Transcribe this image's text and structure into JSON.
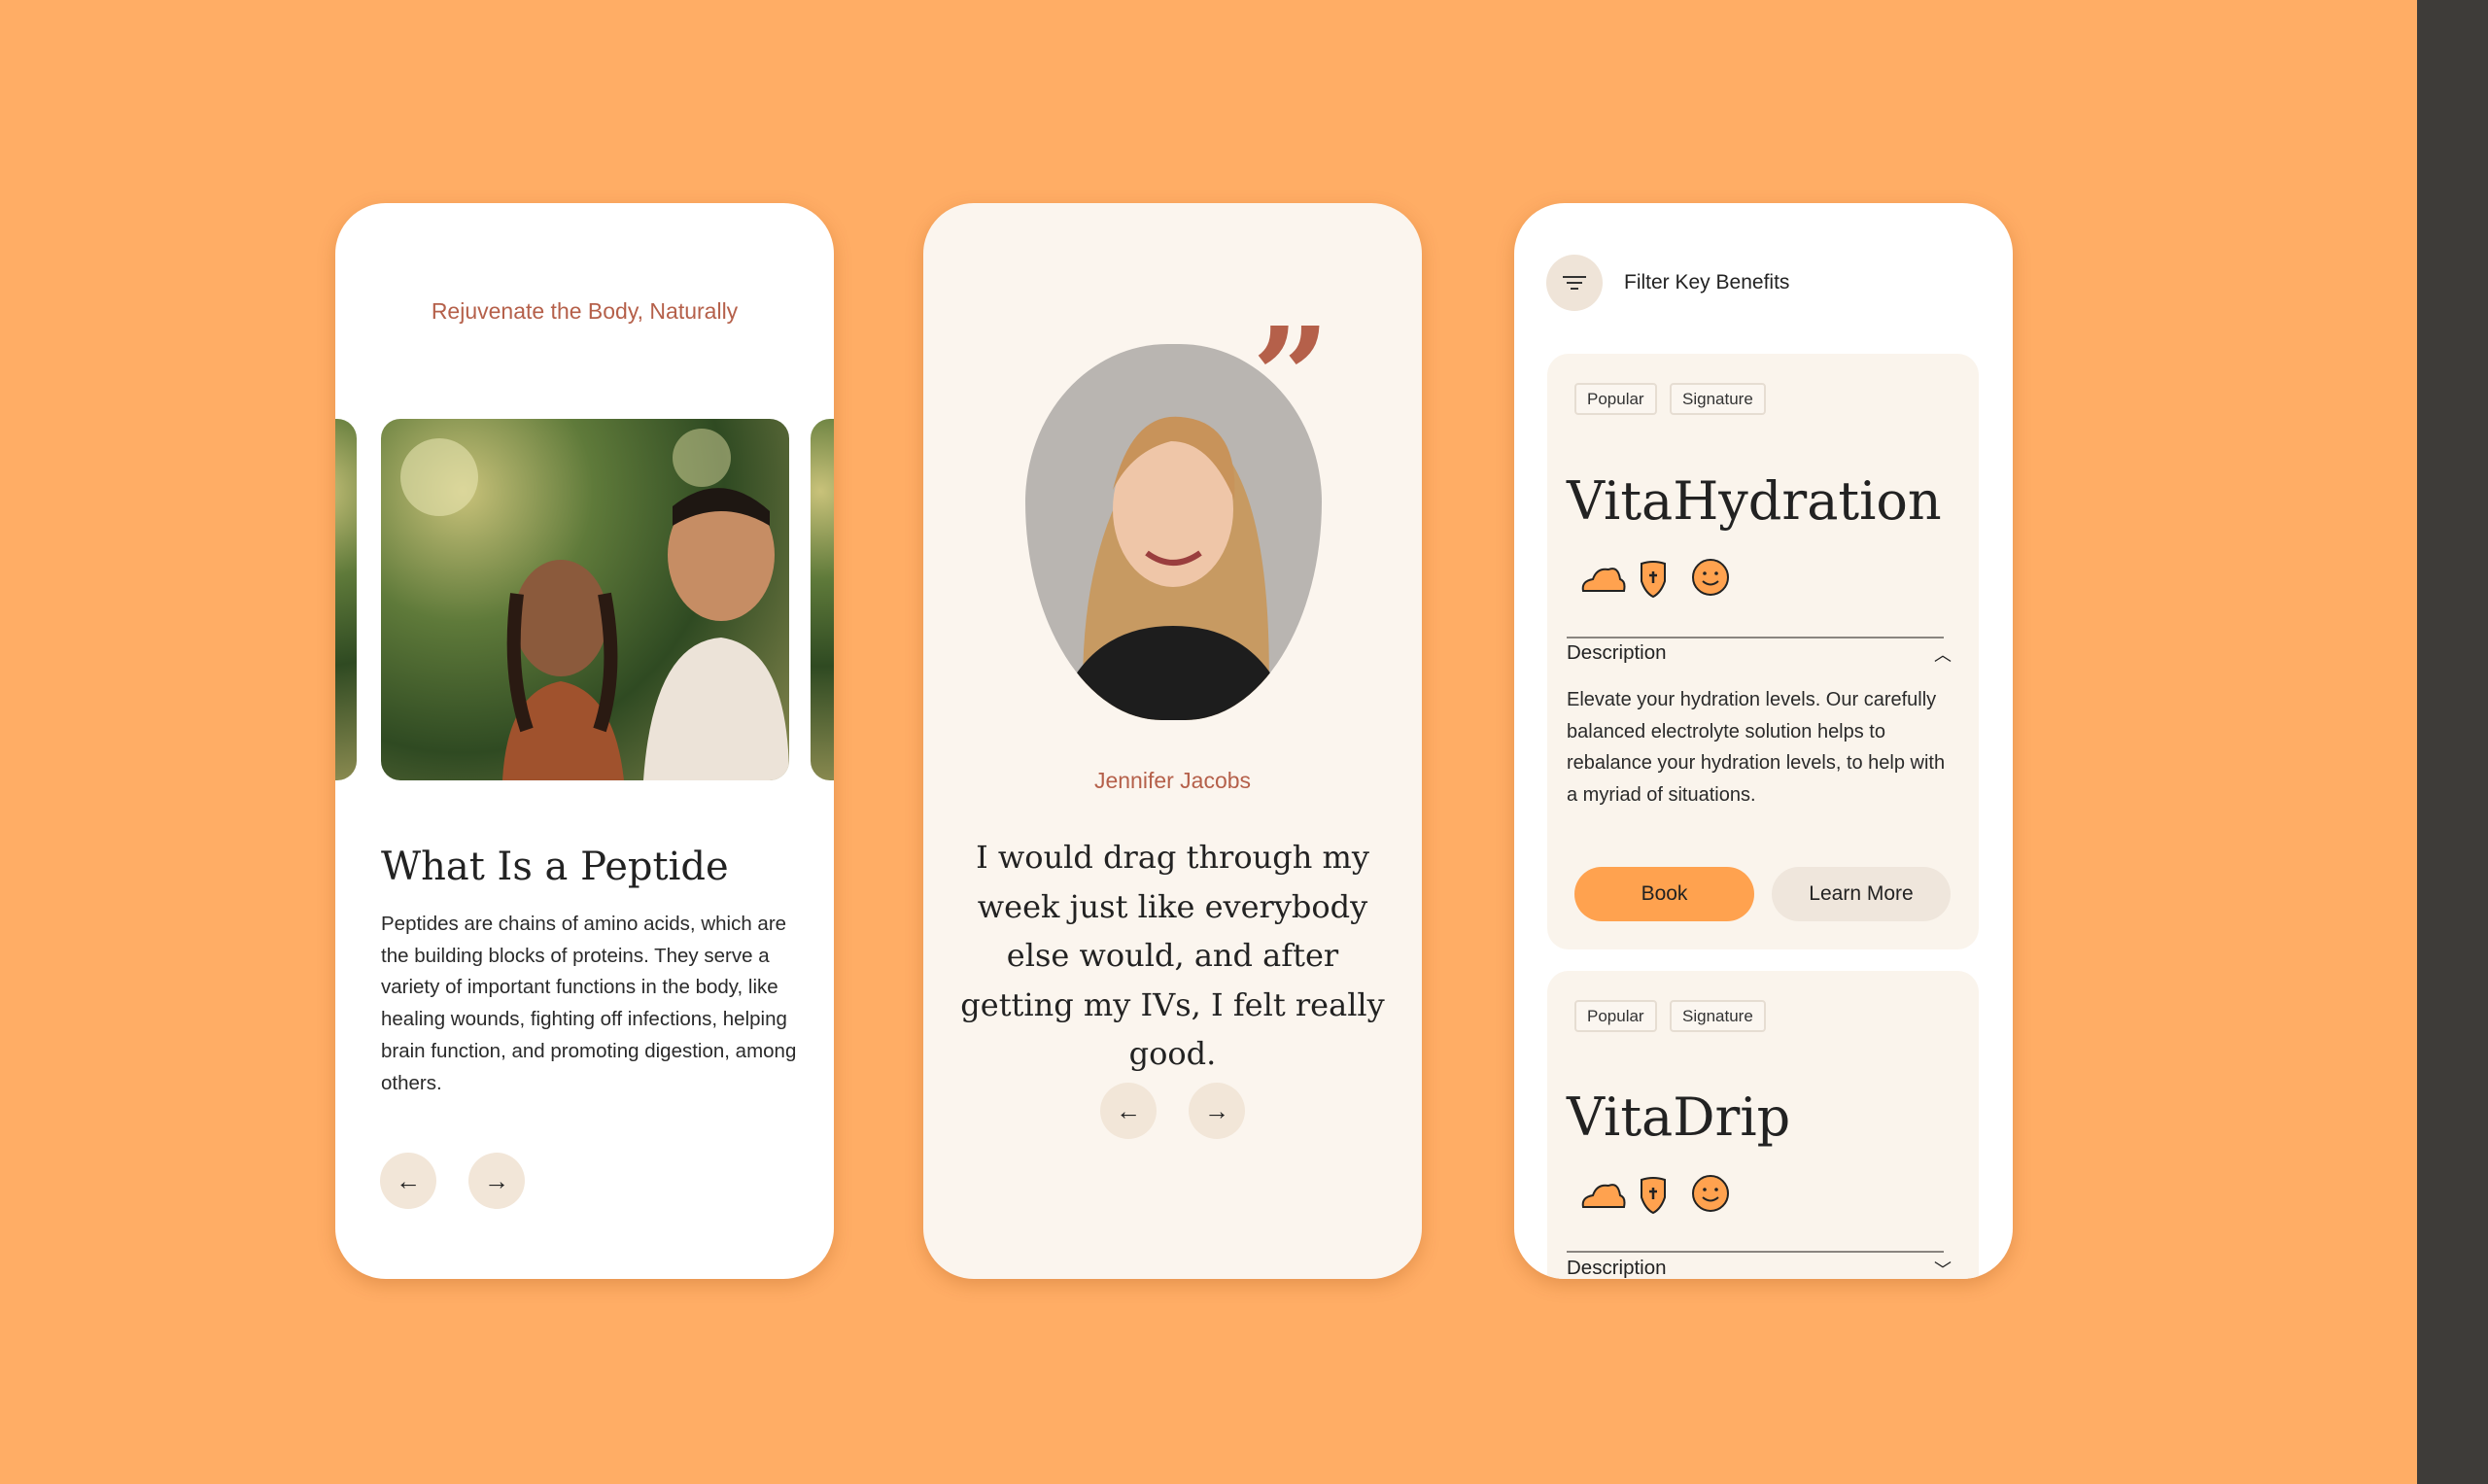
{
  "colors": {
    "background": "#ffad65",
    "accent": "#ffa24f",
    "rust": "#b5604a",
    "cream": "#fbf5ee"
  },
  "card1": {
    "eyebrow": "Rejuvenate the Body, Naturally",
    "title": "What Is a Peptide",
    "body": "Peptides are chains of amino acids, which are the building blocks of proteins. They serve a variety of important functions in the body, like healing wounds, fighting off infections, helping brain function, and promoting digestion, among others.",
    "prev_icon": "arrow-left-icon",
    "next_icon": "arrow-right-icon"
  },
  "card2": {
    "name": "Jennifer Jacobs",
    "quote": "I would drag through my week just like everybody else would, and after getting my IVs, I felt really good.",
    "quote_icon": "quote-mark-icon"
  },
  "card3": {
    "filter_label": "Filter Key Benefits",
    "filter_icon": "filter-icon",
    "products": [
      {
        "tags": [
          "Popular",
          "Signature"
        ],
        "name": "VitaHydration",
        "icons": [
          "cloud-icon",
          "shield-plus-icon",
          "smiley-icon"
        ],
        "accordion_label": "Description",
        "expanded": true,
        "description": "Elevate your hydration levels. Our carefully balanced electrolyte solution helps to rebalance your hydration levels, to help with a myriad of situations.",
        "book_label": "Book",
        "learn_more_label": "Learn More"
      },
      {
        "tags": [
          "Popular",
          "Signature"
        ],
        "name": "VitaDrip",
        "icons": [
          "cloud-icon",
          "shield-plus-icon",
          "smiley-icon"
        ],
        "accordion_label": "Description",
        "expanded": false
      }
    ]
  }
}
